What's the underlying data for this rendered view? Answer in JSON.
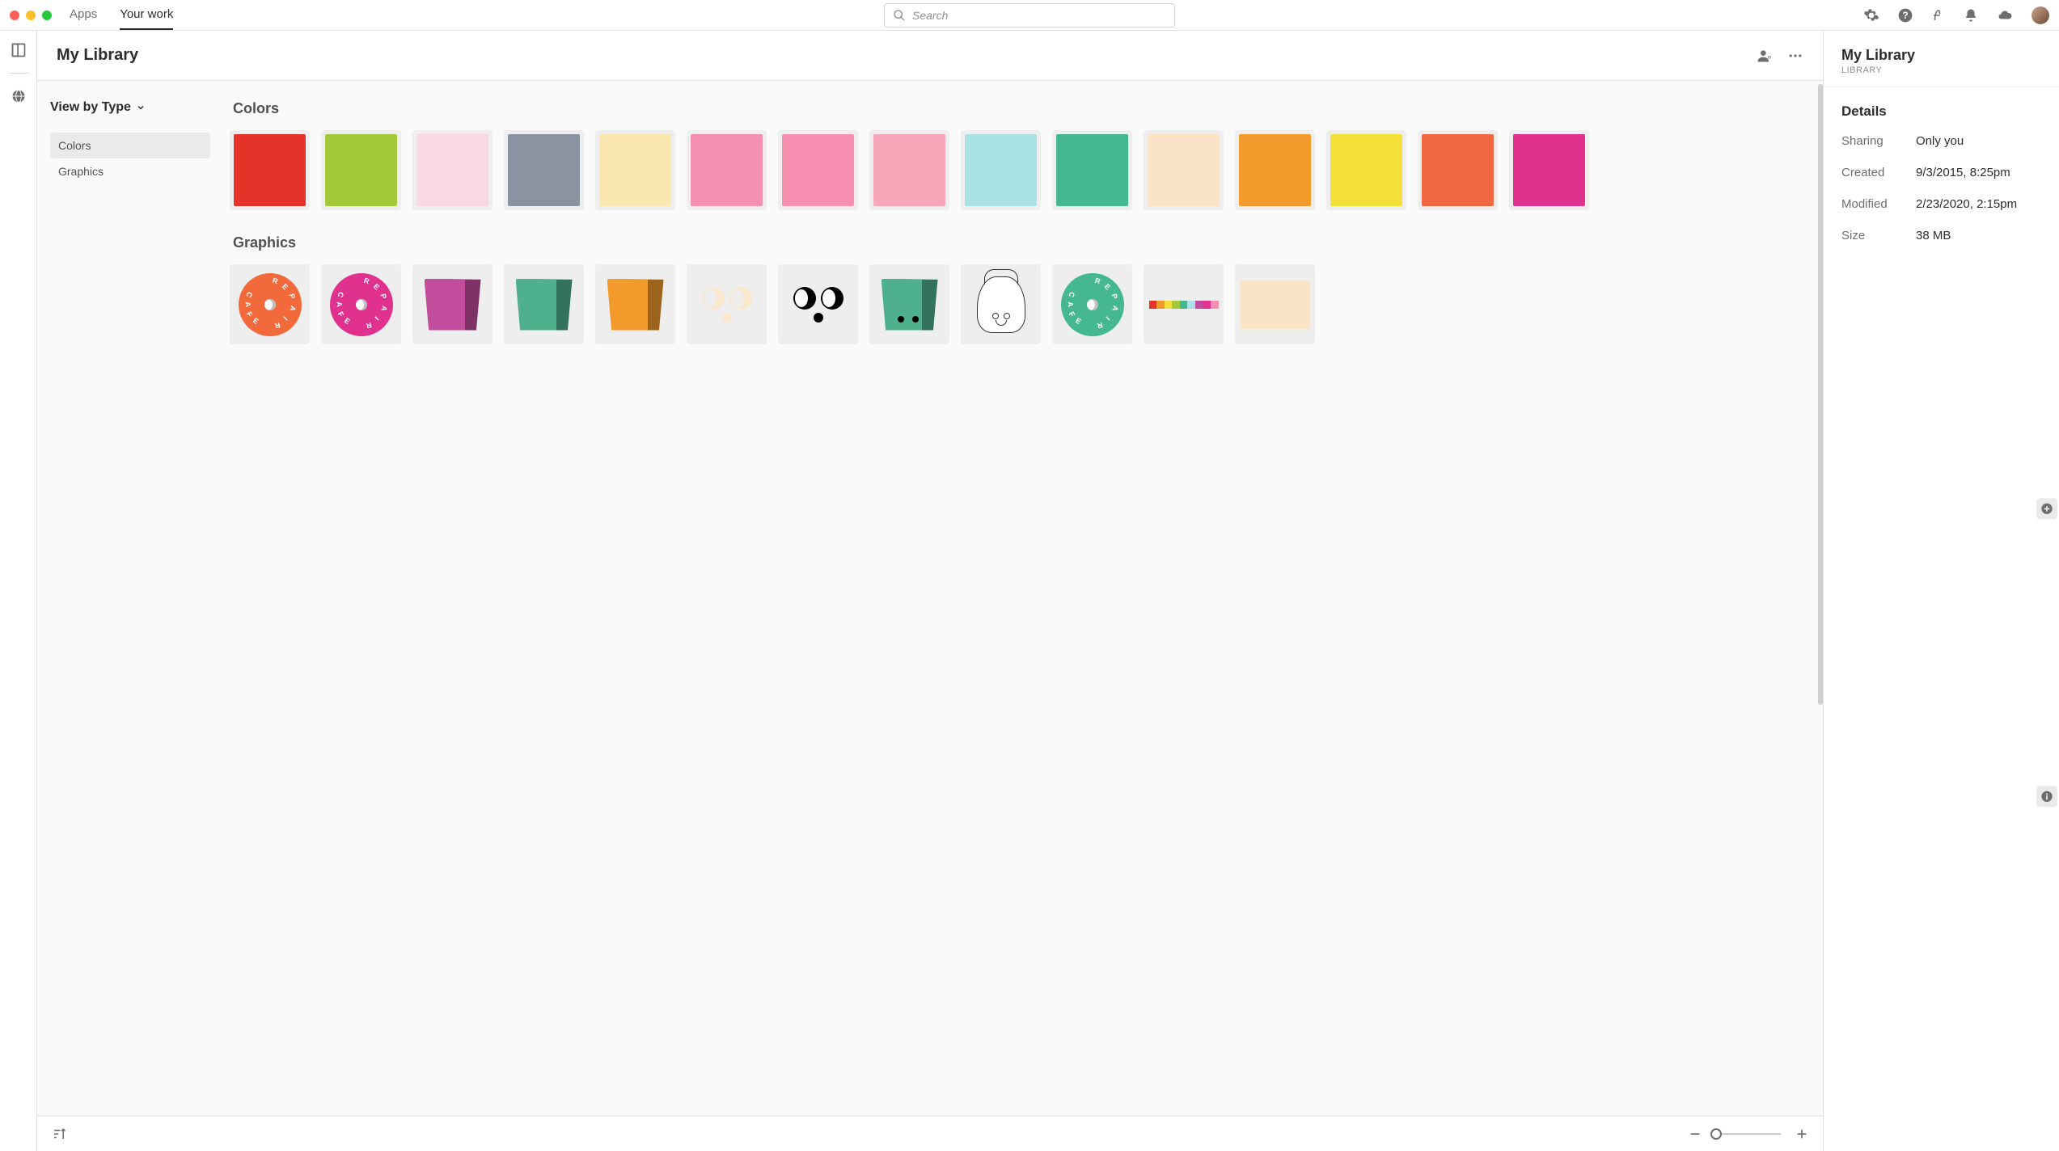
{
  "topbar": {
    "traffic_colors": [
      "#ff5f57",
      "#febc2e",
      "#28c840"
    ],
    "tabs": [
      {
        "label": "Apps",
        "active": false
      },
      {
        "label": "Your work",
        "active": true
      }
    ],
    "search_placeholder": "Search"
  },
  "leftrail": {},
  "center": {
    "title": "My Library",
    "view_label": "View by Type",
    "categories": [
      {
        "label": "Colors",
        "selected": true
      },
      {
        "label": "Graphics",
        "selected": false
      }
    ],
    "sections": {
      "colors_title": "Colors",
      "graphics_title": "Graphics"
    },
    "colors": [
      "#e6332a",
      "#a3c93a",
      "#f8d8e4",
      "#8a93a1",
      "#fbe8b1",
      "#f48fb1",
      "#f78fb1",
      "#f8a6b9",
      "#a9e1e5",
      "#45b890",
      "#fbe4c6",
      "#f29b2c",
      "#f4e03b",
      "#ef6843",
      "#e0318f"
    ],
    "graphics": [
      {
        "type": "badge",
        "bg": "#f26a3b",
        "text": "REPAIR CAFE"
      },
      {
        "type": "badge",
        "bg": "#e0318f",
        "text": "REPAIR CAFE"
      },
      {
        "type": "bucket",
        "color": "#c24d9d"
      },
      {
        "type": "bucket",
        "color": "#4fb08d"
      },
      {
        "type": "bucket",
        "color": "#f29b2c"
      },
      {
        "type": "eyes-cream"
      },
      {
        "type": "eyes-black"
      },
      {
        "type": "bucket-face",
        "color": "#4fb08d"
      },
      {
        "type": "sketch"
      },
      {
        "type": "badge",
        "bg": "#45b890",
        "text": "REPAIR CAFE"
      },
      {
        "type": "stripe",
        "colors": [
          "#e6332a",
          "#f29b2c",
          "#f4e03b",
          "#a3c93a",
          "#45b890",
          "#a9e1e5",
          "#c24d9d",
          "#e0318f",
          "#f48fb1"
        ]
      },
      {
        "type": "solid",
        "color": "#fbe4c6"
      }
    ]
  },
  "details": {
    "title": "My Library",
    "subtitle": "LIBRARY",
    "heading": "Details",
    "rows": {
      "sharing_k": "Sharing",
      "sharing_v": "Only you",
      "created_k": "Created",
      "created_v": "9/3/2015, 8:25pm",
      "modified_k": "Modified",
      "modified_v": "2/23/2020, 2:15pm",
      "size_k": "Size",
      "size_v": "38 MB"
    }
  }
}
